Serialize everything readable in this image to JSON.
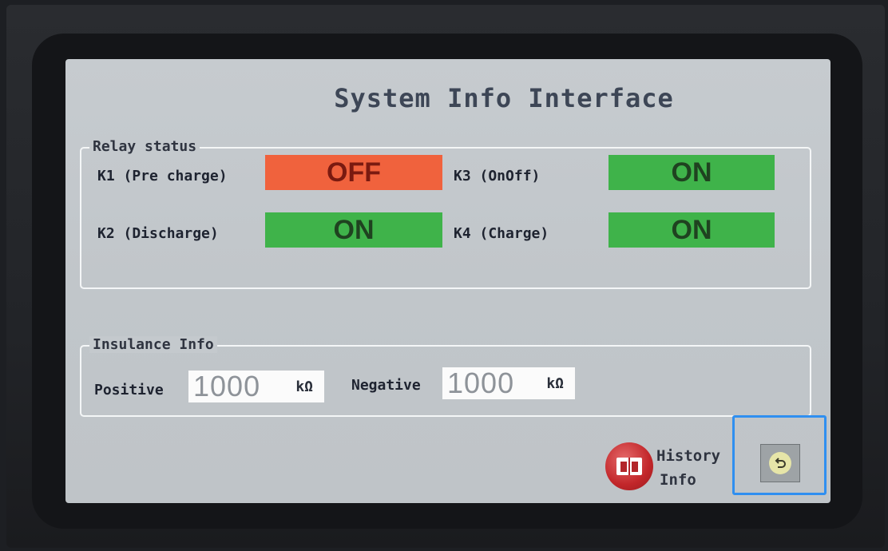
{
  "title": "System Info Interface",
  "relay": {
    "legend": "Relay status",
    "k1": {
      "label": "K1 (Pre charge)",
      "state": "OFF"
    },
    "k2": {
      "label": "K2 (Discharge)",
      "state": "ON"
    },
    "k3": {
      "label": "K3 (OnOff)",
      "state": "ON"
    },
    "k4": {
      "label": "K4 (Charge)",
      "state": "ON"
    }
  },
  "insulance": {
    "legend": "Insulance Info",
    "positive": {
      "label": "Positive",
      "value": "1000",
      "unit": "kΩ"
    },
    "negative": {
      "label": "Negative",
      "value": "1000",
      "unit": "kΩ"
    }
  },
  "history": {
    "line1": "History",
    "line2": "Info"
  },
  "colors": {
    "on": "#3fb34a",
    "off": "#f0623d",
    "highlight": "#2f8ff0"
  }
}
